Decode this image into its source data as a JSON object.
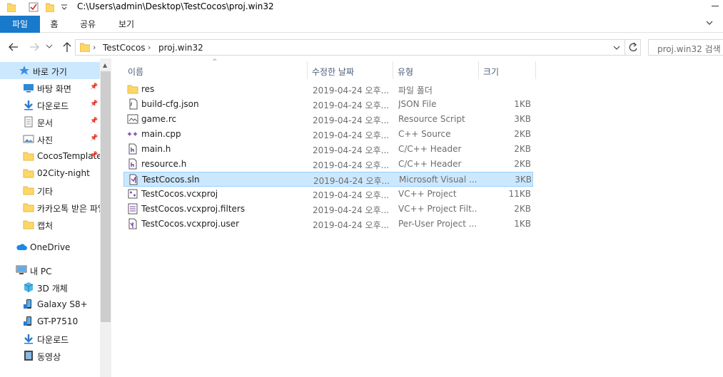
{
  "titlebar": {
    "path": "C:\\Users\\admin\\Desktop\\TestCocos\\proj.win32"
  },
  "ribbon": {
    "tabs": [
      "파일",
      "홈",
      "공유",
      "보기"
    ]
  },
  "address": {
    "crumbs": [
      "TestCocos",
      "proj.win32"
    ]
  },
  "search": {
    "placeholder": "proj.win32 검색"
  },
  "nav": {
    "items": [
      {
        "label": "바로 가기",
        "icon": "star-icon",
        "pinned": false,
        "selected": true
      },
      {
        "label": "바탕 화면",
        "icon": "desktop-icon",
        "pinned": true
      },
      {
        "label": "다운로드",
        "icon": "download-arrow-icon",
        "pinned": true
      },
      {
        "label": "문서",
        "icon": "document-icon",
        "pinned": true
      },
      {
        "label": "사진",
        "icon": "picture-icon",
        "pinned": true
      },
      {
        "label": "CocosTemplate",
        "icon": "folder-icon",
        "pinned": true
      },
      {
        "label": "02City-night",
        "icon": "folder-icon",
        "pinned": false
      },
      {
        "label": "기타",
        "icon": "folder-icon",
        "pinned": false
      },
      {
        "label": "카카오톡 받은 파일",
        "icon": "folder-icon",
        "pinned": false
      },
      {
        "label": "캡처",
        "icon": "folder-icon",
        "pinned": false
      },
      {
        "label": "OneDrive",
        "icon": "cloud-icon",
        "pinned": false
      },
      {
        "label": "내 PC",
        "icon": "computer-icon",
        "pinned": false
      },
      {
        "label": "3D 개체",
        "icon": "cube-icon",
        "pinned": false
      },
      {
        "label": "Galaxy S8+",
        "icon": "phone-icon",
        "pinned": false
      },
      {
        "label": "GT-P7510",
        "icon": "phone-icon",
        "pinned": false
      },
      {
        "label": "다운로드",
        "icon": "download-arrow-icon",
        "pinned": false
      },
      {
        "label": "동영상",
        "icon": "video-icon",
        "pinned": false
      }
    ]
  },
  "columns": [
    "이름",
    "수정한 날짜",
    "유형",
    "크기"
  ],
  "files": [
    {
      "name": "res",
      "date": "2019-04-24 오후...",
      "type": "파일 폴더",
      "size": "",
      "icon": "folder-icon"
    },
    {
      "name": "build-cfg.json",
      "date": "2019-04-24 오후...",
      "type": "JSON File",
      "size": "1KB",
      "icon": "json-file-icon"
    },
    {
      "name": "game.rc",
      "date": "2019-04-24 오후...",
      "type": "Resource Script",
      "size": "3KB",
      "icon": "rc-file-icon"
    },
    {
      "name": "main.cpp",
      "date": "2019-04-24 오후...",
      "type": "C++ Source",
      "size": "2KB",
      "icon": "cpp-file-icon"
    },
    {
      "name": "main.h",
      "date": "2019-04-24 오후...",
      "type": "C/C++ Header",
      "size": "2KB",
      "icon": "header-file-icon"
    },
    {
      "name": "resource.h",
      "date": "2019-04-24 오후...",
      "type": "C/C++ Header",
      "size": "2KB",
      "icon": "header-file-icon"
    },
    {
      "name": "TestCocos.sln",
      "date": "2019-04-24 오후...",
      "type": "Microsoft Visual ...",
      "size": "3KB",
      "icon": "sln-file-icon",
      "selected": true
    },
    {
      "name": "TestCocos.vcxproj",
      "date": "2019-04-24 오후...",
      "type": "VC++ Project",
      "size": "11KB",
      "icon": "vcxproj-file-icon"
    },
    {
      "name": "TestCocos.vcxproj.filters",
      "date": "2019-04-24 오후...",
      "type": "VC++ Project Filt...",
      "size": "2KB",
      "icon": "filters-file-icon"
    },
    {
      "name": "TestCocos.vcxproj.user",
      "date": "2019-04-24 오후...",
      "type": "Per-User Project ...",
      "size": "1KB",
      "icon": "user-file-icon"
    }
  ],
  "colors": {
    "accent": "#1979ca",
    "selection": "#cce8ff",
    "folder": "#ffd766"
  }
}
